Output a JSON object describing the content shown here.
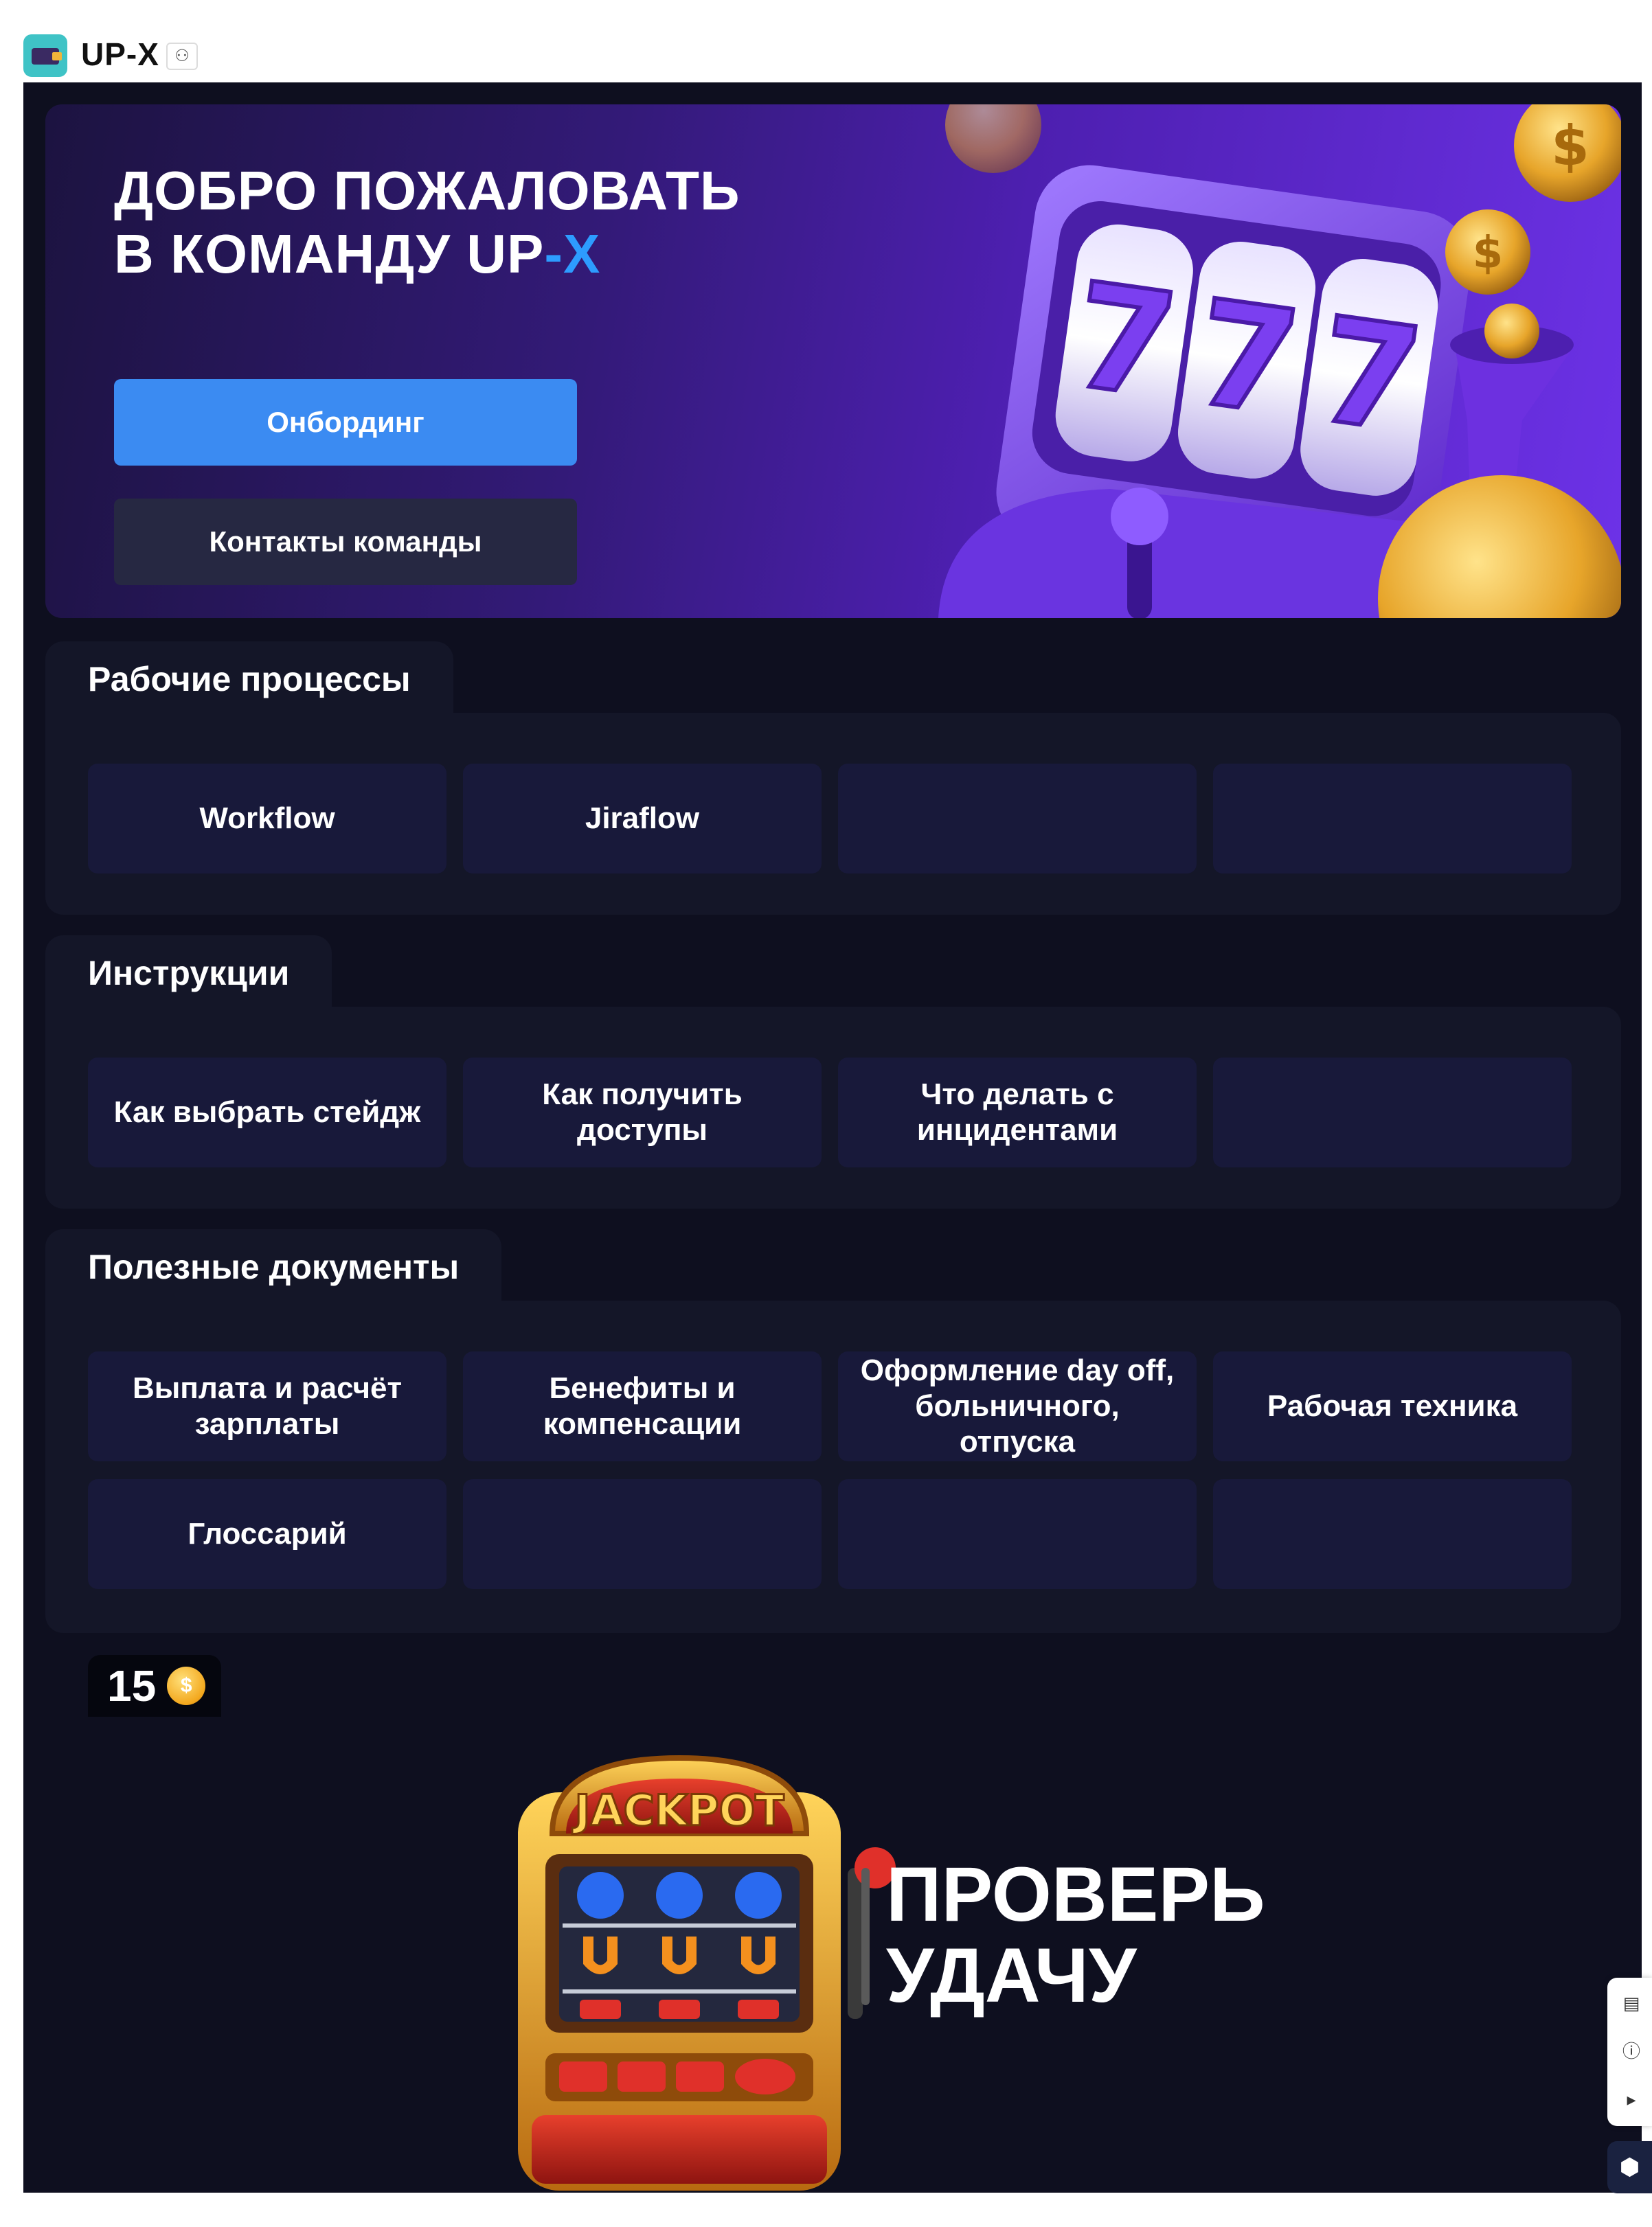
{
  "app": {
    "title": "UP-X"
  },
  "hero": {
    "title_line1": "ДОБРО ПОЖАЛОВАТЬ",
    "title_line2_prefix": "В КОМАНДУ UP",
    "title_line2_dash": "-",
    "title_line2_x": "X",
    "primary_button": "Онбординг",
    "secondary_button": "Контакты команды",
    "reels": [
      "7",
      "7",
      "7"
    ]
  },
  "sections": [
    {
      "title": "Рабочие процессы",
      "cards": [
        "Workflow",
        "Jiraflow",
        "",
        ""
      ]
    },
    {
      "title": "Инструкции",
      "cards": [
        "Как выбрать стейдж",
        "Как получить доступы",
        "Что делать с инцидентами",
        ""
      ]
    },
    {
      "title": "Полезные документы",
      "cards": [
        "Выплата и расчёт зарплаты",
        "Бенефиты и компенсации",
        "Оформление day off, больничного, отпуска",
        "Рабочая техника",
        "Глоссарий",
        "",
        "",
        ""
      ]
    }
  ],
  "luck": {
    "coins": "15",
    "coin_symbol": "$",
    "jackpot_label": "JACKPOT",
    "title_line1": "ПРОВЕРЬ",
    "title_line2": "УДАЧУ"
  },
  "colors": {
    "page_bg": "#0e0f1f",
    "accent_blue": "#3b8bf2",
    "x_accent": "#2d9cff",
    "card_bg": "#18193a",
    "section_bg": "#141628"
  },
  "toolbar": {
    "icons": [
      "comment-icon",
      "info-icon",
      "megaphone-icon",
      "app-switch-icon"
    ]
  }
}
